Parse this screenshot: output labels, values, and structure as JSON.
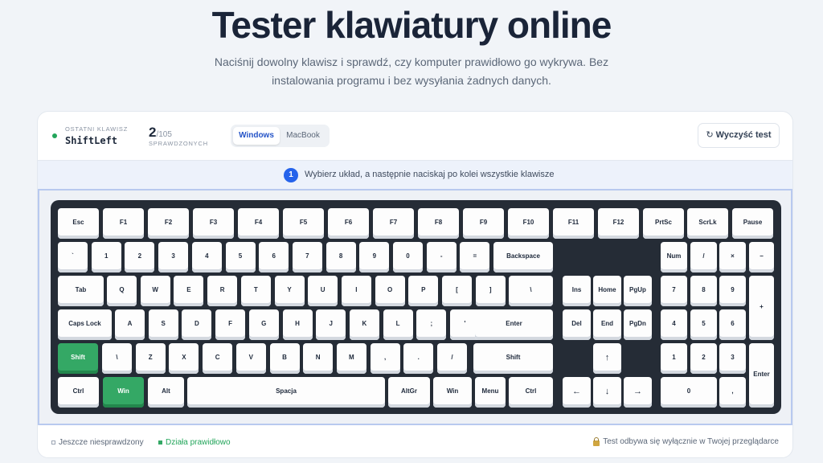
{
  "page": {
    "title": "Tester klawiatury online",
    "subtitle": "Naciśnij dowolny klawisz i sprawdź, czy komputer prawidłowo go wykrywa. Bez instalowania programu i bez wysyłania żadnych danych."
  },
  "toolbar": {
    "last_key_label": "OSTATNI KLAWISZ",
    "last_key_value": "ShiftLeft",
    "checked_count": "2",
    "total_count": "/105",
    "checked_label": "SPRAWDZONYCH",
    "layouts": [
      "Windows",
      "MacBook"
    ],
    "active_layout": "Windows",
    "clear_icon": "↻",
    "clear_label": "Wyczyść test"
  },
  "hint": {
    "step": "1",
    "text": "Wybierz układ, a następnie naciskaj po kolei wszystkie klawisze"
  },
  "colors": {
    "accent": "#2563eb",
    "key_ok": "#34a865",
    "keyboard_bg": "#252c36"
  },
  "keyboard": {
    "function_row": [
      "Esc",
      "F1",
      "F2",
      "F3",
      "F4",
      "F5",
      "F6",
      "F7",
      "F8",
      "F9",
      "F10",
      "F11",
      "F12",
      "PrtSc",
      "ScrLk",
      "Pause"
    ],
    "number_row": [
      "`",
      "1",
      "2",
      "3",
      "4",
      "5",
      "6",
      "7",
      "8",
      "9",
      "0",
      "-",
      "=",
      "Backspace"
    ],
    "tab_row": [
      "Tab",
      "Q",
      "W",
      "E",
      "R",
      "T",
      "Y",
      "U",
      "I",
      "O",
      "P",
      "[",
      "]",
      "\\"
    ],
    "caps_row": [
      "Caps Lock",
      "A",
      "S",
      "D",
      "F",
      "G",
      "H",
      "J",
      "K",
      "L",
      ";",
      "'",
      "Enter"
    ],
    "shift_row": [
      "Shift",
      "\\",
      "Z",
      "X",
      "C",
      "V",
      "B",
      "N",
      "M",
      ",",
      ".",
      "/",
      "Shift"
    ],
    "bottom_row": [
      "Ctrl",
      "Win",
      "Alt",
      "Spacja",
      "AltGr",
      "Win",
      "Menu",
      "Ctrl"
    ],
    "nav_top": [
      "Ins",
      "Home",
      "PgUp"
    ],
    "nav_bottom": [
      "Del",
      "End",
      "PgDn"
    ],
    "arrows": [
      "↑",
      "←",
      "↓",
      "→"
    ],
    "numpad": [
      "Num",
      "/",
      "×",
      "−",
      "7",
      "8",
      "9",
      "+",
      "4",
      "5",
      "6",
      "1",
      "2",
      "3",
      "Enter",
      "0",
      ","
    ],
    "tested_keys": [
      "ShiftLeft",
      "WinLeft"
    ]
  },
  "footer": {
    "legend_untested": "Jeszcze niesprawdzony",
    "legend_ok": "Działa prawidłowo",
    "privacy": "Test odbywa się wyłącznie w Twojej przeglądarce"
  }
}
